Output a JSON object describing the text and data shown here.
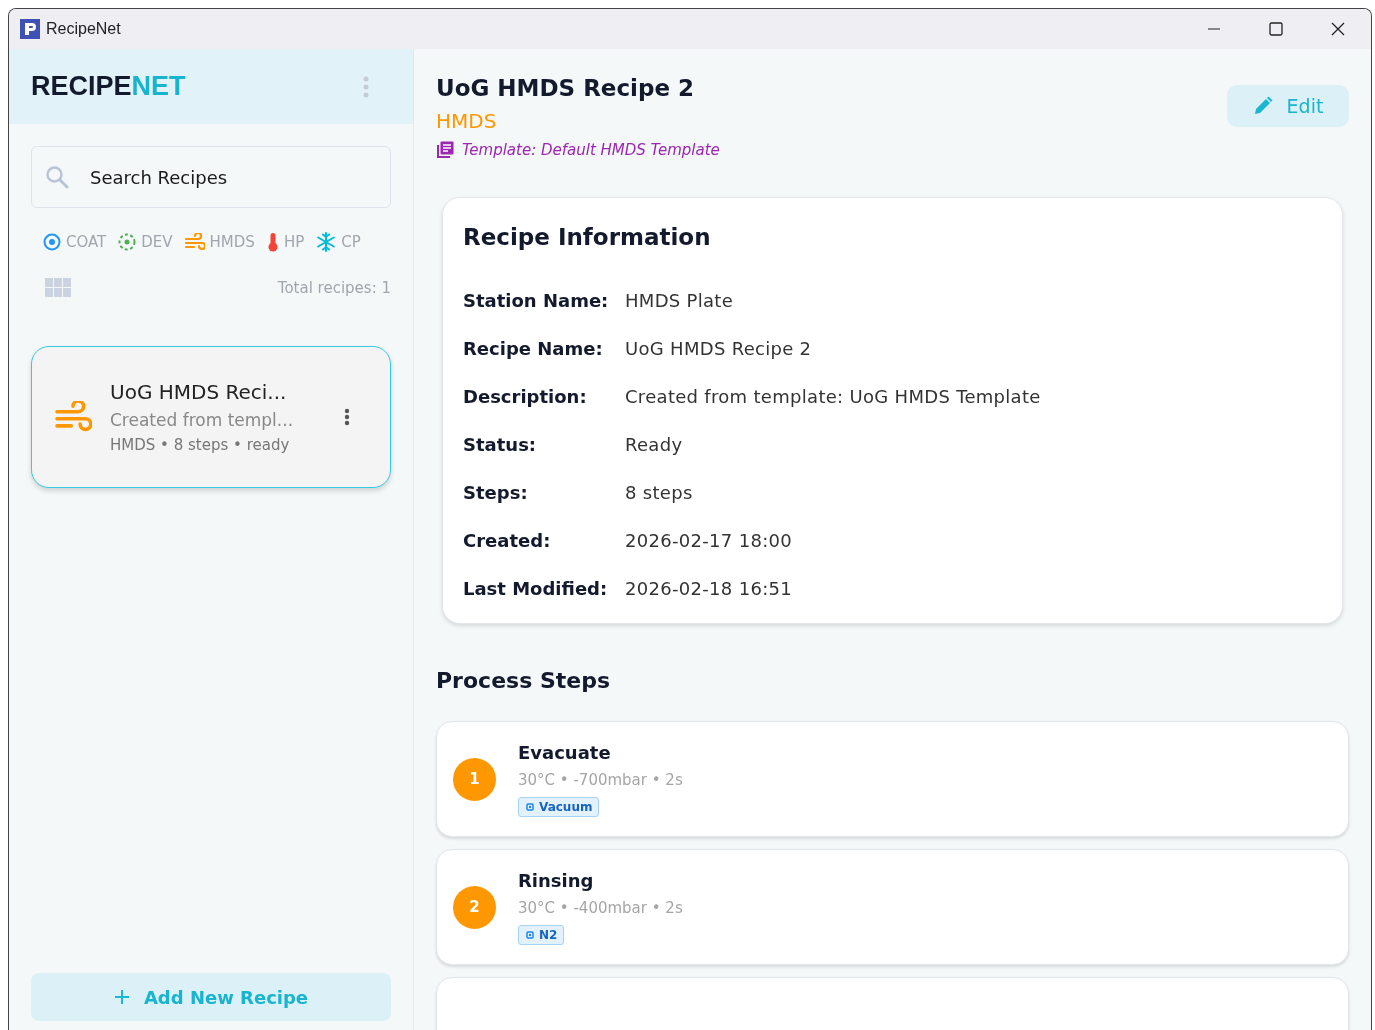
{
  "window": {
    "title": "RecipeNet"
  },
  "sidebar": {
    "brand": {
      "dark": "RECIPE",
      "accent": "NET"
    },
    "search": {
      "placeholder": "Search Recipes"
    },
    "filters": [
      {
        "kind": "coat",
        "label": "COAT"
      },
      {
        "kind": "dev",
        "label": "DEV"
      },
      {
        "kind": "hmds",
        "label": "HMDS"
      },
      {
        "kind": "hp",
        "label": "HP"
      },
      {
        "kind": "cp",
        "label": "CP"
      }
    ],
    "total": "Total recipes: 1",
    "recipes": [
      {
        "kind": "hmds",
        "title": "UoG HMDS Reci...",
        "subtitle": "Created from templ...",
        "meta": "HMDS • 8 steps • ready",
        "selected": true
      }
    ],
    "add_button": "Add New Recipe"
  },
  "detail": {
    "title": "UoG HMDS Recipe 2",
    "station_type": "HMDS",
    "template": "Template: Default HMDS Template",
    "edit_button": "Edit",
    "info": {
      "heading": "Recipe Information",
      "rows": [
        {
          "label": "Station Name:",
          "value": "HMDS Plate"
        },
        {
          "label": "Recipe Name:",
          "value": "UoG HMDS Recipe 2"
        },
        {
          "label": "Description:",
          "value": "Created from template: UoG HMDS Template"
        },
        {
          "label": "Status:",
          "value": "Ready"
        },
        {
          "label": "Steps:",
          "value": "8 steps"
        },
        {
          "label": "Created:",
          "value": "2026-02-17 18:00"
        },
        {
          "label": "Last Modified:",
          "value": "2026-02-18 16:51"
        }
      ]
    },
    "steps_heading": "Process Steps",
    "steps": [
      {
        "number": "1",
        "name": "Evacuate",
        "params": "30°C • -700mbar • 2s",
        "tag": "Vacuum"
      },
      {
        "number": "2",
        "name": "Rinsing",
        "params": "30°C • -400mbar • 2s",
        "tag": "N2"
      }
    ]
  }
}
